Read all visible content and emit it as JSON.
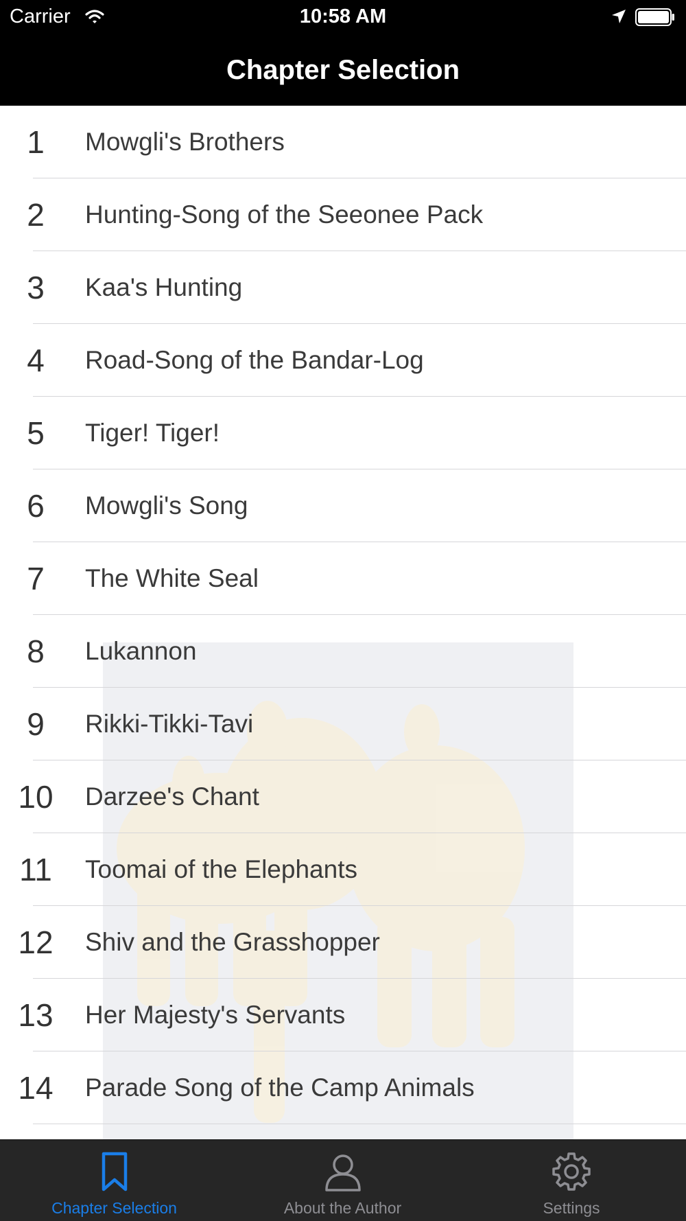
{
  "status_bar": {
    "carrier": "Carrier",
    "time": "10:58 AM"
  },
  "nav": {
    "title": "Chapter Selection"
  },
  "chapters": [
    {
      "number": "1",
      "title": "Mowgli's Brothers"
    },
    {
      "number": "2",
      "title": "Hunting-Song of the Seeonee Pack"
    },
    {
      "number": "3",
      "title": "Kaa's Hunting"
    },
    {
      "number": "4",
      "title": "Road-Song of the Bandar-Log"
    },
    {
      "number": "5",
      "title": "Tiger! Tiger!"
    },
    {
      "number": "6",
      "title": "Mowgli's Song"
    },
    {
      "number": "7",
      "title": "The White Seal"
    },
    {
      "number": "8",
      "title": "Lukannon"
    },
    {
      "number": "9",
      "title": "Rikki-Tikki-Tavi"
    },
    {
      "number": "10",
      "title": "Darzee's Chant"
    },
    {
      "number": "11",
      "title": "Toomai of the Elephants"
    },
    {
      "number": "12",
      "title": "Shiv and the Grasshopper"
    },
    {
      "number": "13",
      "title": "Her Majesty's Servants"
    },
    {
      "number": "14",
      "title": "Parade Song of the Camp Animals"
    }
  ],
  "tab_bar": {
    "tabs": [
      {
        "label": "Chapter Selection",
        "icon": "bookmark-icon",
        "active": true
      },
      {
        "label": "About the Author",
        "icon": "person-icon",
        "active": false
      },
      {
        "label": "Settings",
        "icon": "gear-icon",
        "active": false
      }
    ],
    "active_color": "#1a7ee8",
    "inactive_color": "#8e8e93"
  }
}
